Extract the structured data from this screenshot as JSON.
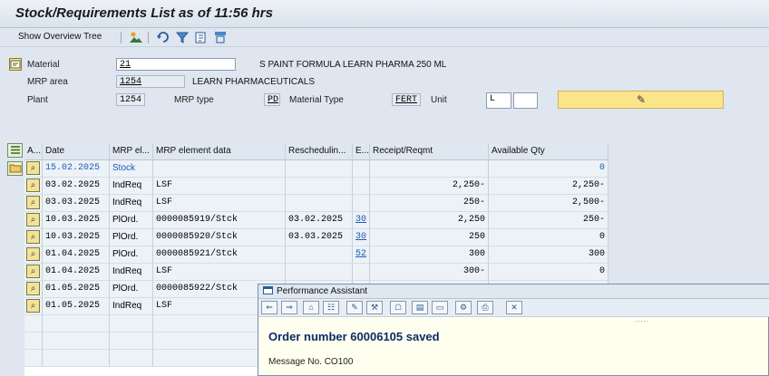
{
  "window": {
    "title": "Stock/Requirements List as of 11:56 hrs"
  },
  "toolbar": {
    "show_overview_tree": "Show Overview Tree"
  },
  "header": {
    "material_label": "Material",
    "material_value": "21",
    "material_desc": "S PAINT FORMULA LEARN PHARMA 250 ML",
    "mrp_area_label": "MRP area",
    "mrp_area_value": "1254",
    "mrp_area_desc": "LEARN PHARMACEUTICALS",
    "plant_label": "Plant",
    "plant_value": "1254",
    "mrp_type_label": "MRP type",
    "mrp_type_value": "PD",
    "material_type_label": "Material Type",
    "material_type_value": "FERT",
    "unit_label": "Unit",
    "unit_value": "L"
  },
  "table": {
    "columns": [
      "A...",
      "Date",
      "MRP el...",
      "MRP element data",
      "Reschedulin...",
      "E...",
      "Receipt/Reqmt",
      "Available Qty"
    ],
    "rows": [
      {
        "date": "15.02.2025",
        "el": "Stock",
        "data": "",
        "resched": "",
        "e": "",
        "receipt": "",
        "avail": "0"
      },
      {
        "date": "03.02.2025",
        "el": "IndReq",
        "data": "LSF",
        "resched": "",
        "e": "",
        "receipt": "2,250-",
        "avail": "2,250-"
      },
      {
        "date": "03.03.2025",
        "el": "IndReq",
        "data": "LSF",
        "resched": "",
        "e": "",
        "receipt": "250-",
        "avail": "2,500-"
      },
      {
        "date": "10.03.2025",
        "el": "PlOrd.",
        "data": "0000085919/Stck",
        "resched": "03.02.2025",
        "e": "30",
        "receipt": "2,250",
        "avail": "250-"
      },
      {
        "date": "10.03.2025",
        "el": "PlOrd.",
        "data": "0000085920/Stck",
        "resched": "03.03.2025",
        "e": "30",
        "receipt": "250",
        "avail": "0"
      },
      {
        "date": "01.04.2025",
        "el": "PlOrd.",
        "data": "0000085921/Stck",
        "resched": "",
        "e": "52",
        "receipt": "300",
        "avail": "300"
      },
      {
        "date": "01.04.2025",
        "el": "IndReq",
        "data": "LSF",
        "resched": "",
        "e": "",
        "receipt": "300-",
        "avail": "0"
      },
      {
        "date": "01.05.2025",
        "el": "PlOrd.",
        "data": "0000085922/Stck",
        "resched": "",
        "e": "",
        "receipt": "",
        "avail": ""
      },
      {
        "date": "01.05.2025",
        "el": "IndReq",
        "data": "LSF",
        "resched": "",
        "e": "",
        "receipt": "",
        "avail": ""
      }
    ]
  },
  "popup": {
    "title": "Performance Assistant",
    "message": "Order number 60006105 saved",
    "message_no": "Message No. CO100",
    "grip": "....."
  },
  "icons": {
    "table": "⊞",
    "refresh": "⟳",
    "filter": "▽",
    "pencil": "✎",
    "magnifier": "🔍"
  },
  "colors": {
    "accent_blue": "#1a5bb8",
    "action_yellow": "#fbe58b",
    "message_navy": "#0e2a66"
  }
}
